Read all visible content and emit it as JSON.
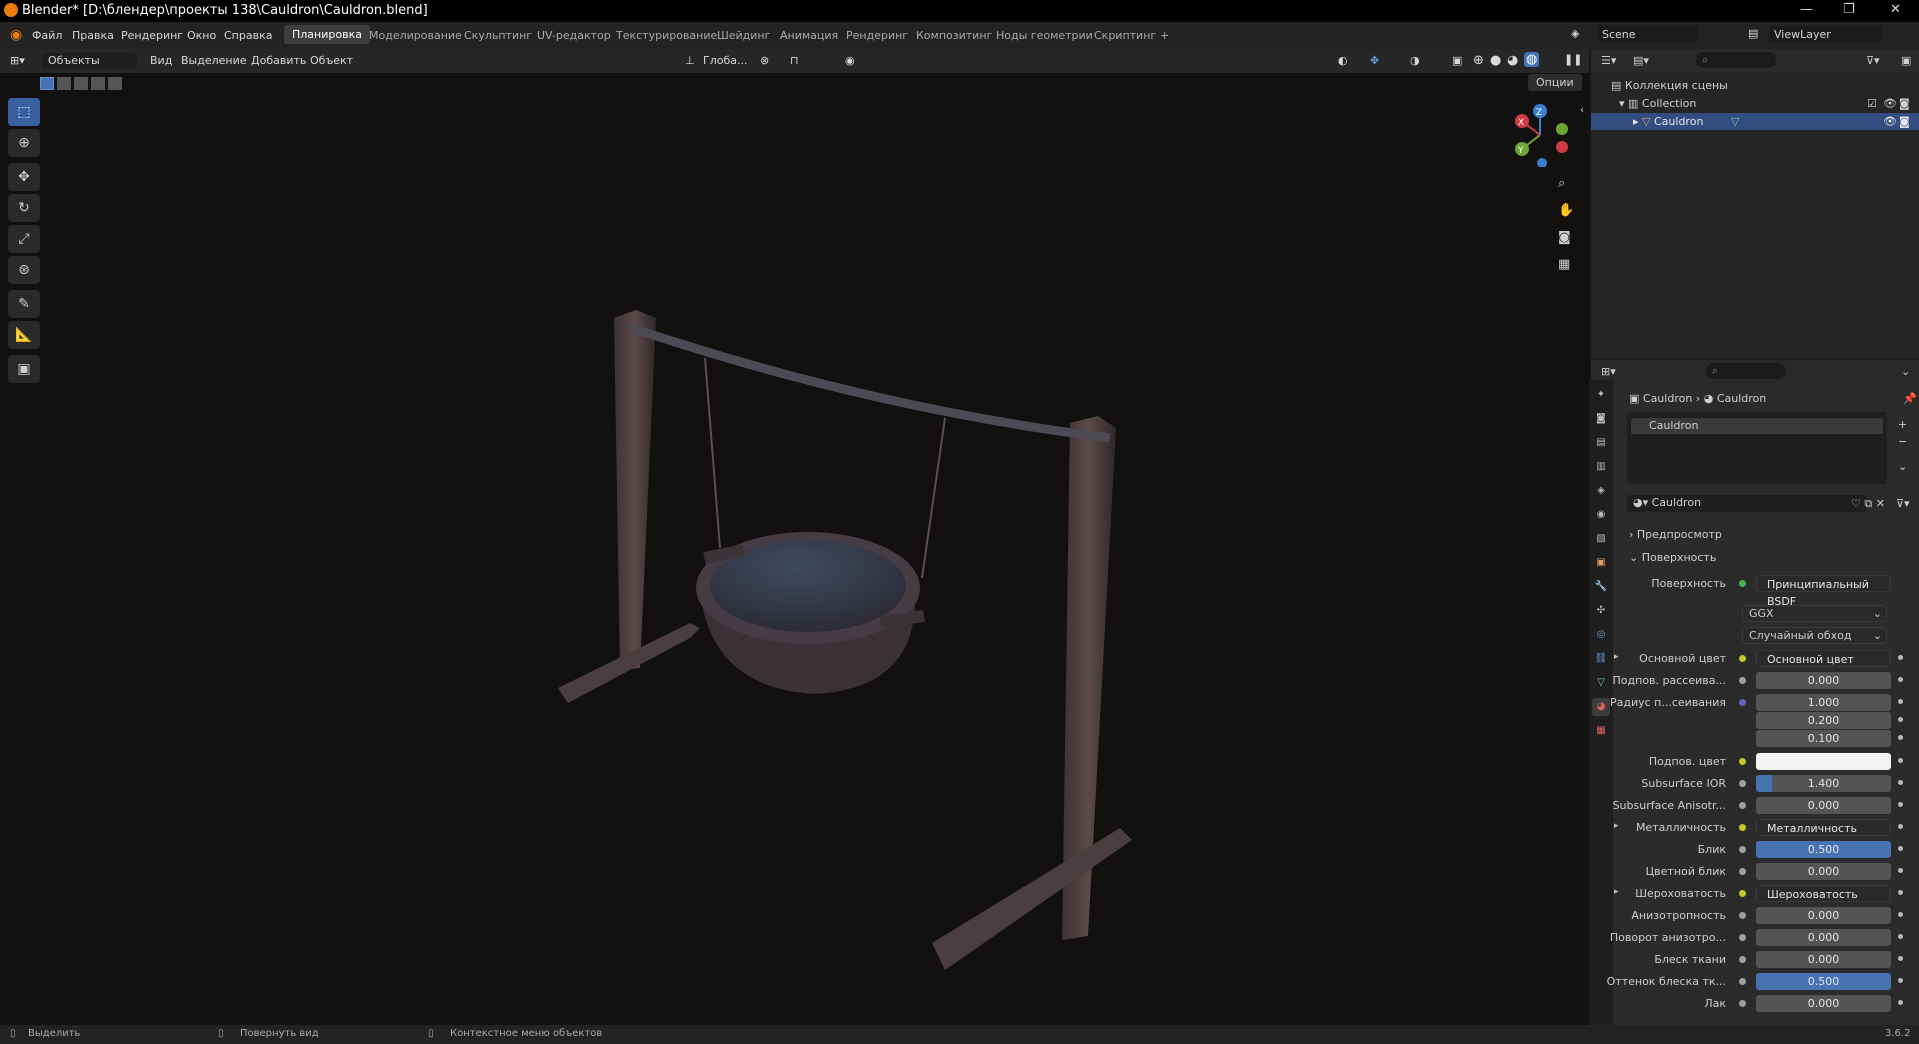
{
  "window": {
    "title": "Blender* [D:\\блендер\\проекты 138\\Cauldron\\Cauldron.blend]"
  },
  "menu": {
    "items": [
      "Файл",
      "Правка",
      "Рендеринг",
      "Окно",
      "Справка"
    ]
  },
  "workspaces": [
    "Планировка",
    "Моделирование",
    "Скульптинг",
    "UV-редактор",
    "Текстурирование",
    "Шейдинг",
    "Анимация",
    "Рендеринг",
    "Композитинг",
    "Ноды геометрии",
    "Скриптинг",
    "+"
  ],
  "active_workspace": "Планировка",
  "scene": {
    "name": "Scene",
    "view_layer": "ViewLayer"
  },
  "viewport_header": {
    "mode": "Объекты",
    "menus": [
      "Вид",
      "Выделение",
      "Добавить",
      "Объект"
    ],
    "orientation": "Глоба...",
    "options": "Опции"
  },
  "outliner": {
    "root": "Коллекция сцены",
    "collection": "Collection",
    "object": "Cauldron"
  },
  "properties": {
    "breadcrumb": [
      "Cauldron",
      "Cauldron"
    ],
    "slot": "Cauldron",
    "material": "Cauldron",
    "panels": {
      "preview": "Предпросмотр",
      "surface": "Поверхность"
    },
    "surface_label": "Поверхность",
    "surface_value": "Принципиальный BSDF",
    "distribution": "GGX",
    "subsurface_method": "Случайный обход",
    "rows": [
      {
        "label": "Основной цвет",
        "value": "Основной цвет",
        "type": "link",
        "arrow": true
      },
      {
        "label": "Подпов. рассеива...",
        "value": "0.000"
      },
      {
        "label": "Радиус п...сеивания",
        "value": "1.000",
        "dot": "b"
      },
      {
        "label": "",
        "value": "0.200"
      },
      {
        "label": "",
        "value": "0.100"
      },
      {
        "label": "Подпов. цвет",
        "value": "",
        "type": "white"
      },
      {
        "label": "Subsurface IOR",
        "value": "1.400",
        "type": "ior"
      },
      {
        "label": "Subsurface Anisotr...",
        "value": "0.000"
      },
      {
        "label": "Металличность",
        "value": "Металличность",
        "type": "link",
        "arrow": true
      },
      {
        "label": "Блик",
        "value": "0.500",
        "type": "blue"
      },
      {
        "label": "Цветной блик",
        "value": "0.000"
      },
      {
        "label": "Шероховатость",
        "value": "Шероховатость",
        "type": "link",
        "arrow": true
      },
      {
        "label": "Анизотропность",
        "value": "0.000"
      },
      {
        "label": "Поворот анизотро...",
        "value": "0.000"
      },
      {
        "label": "Блеск ткани",
        "value": "0.000"
      },
      {
        "label": "Оттенок блеска тк...",
        "value": "0.500",
        "type": "blue"
      },
      {
        "label": "Лак",
        "value": "0.000"
      }
    ]
  },
  "statusbar": {
    "items": [
      "Выделить",
      "Повернуть вид",
      "Контекстное меню объектов"
    ],
    "version": "3.6.2"
  },
  "colors": {
    "accent": "#4772b3",
    "select_blue": "#3a5fa0",
    "gizmo_x": "#d03a44",
    "gizmo_y": "#6ea534",
    "gizmo_z": "#3a7ed0"
  }
}
